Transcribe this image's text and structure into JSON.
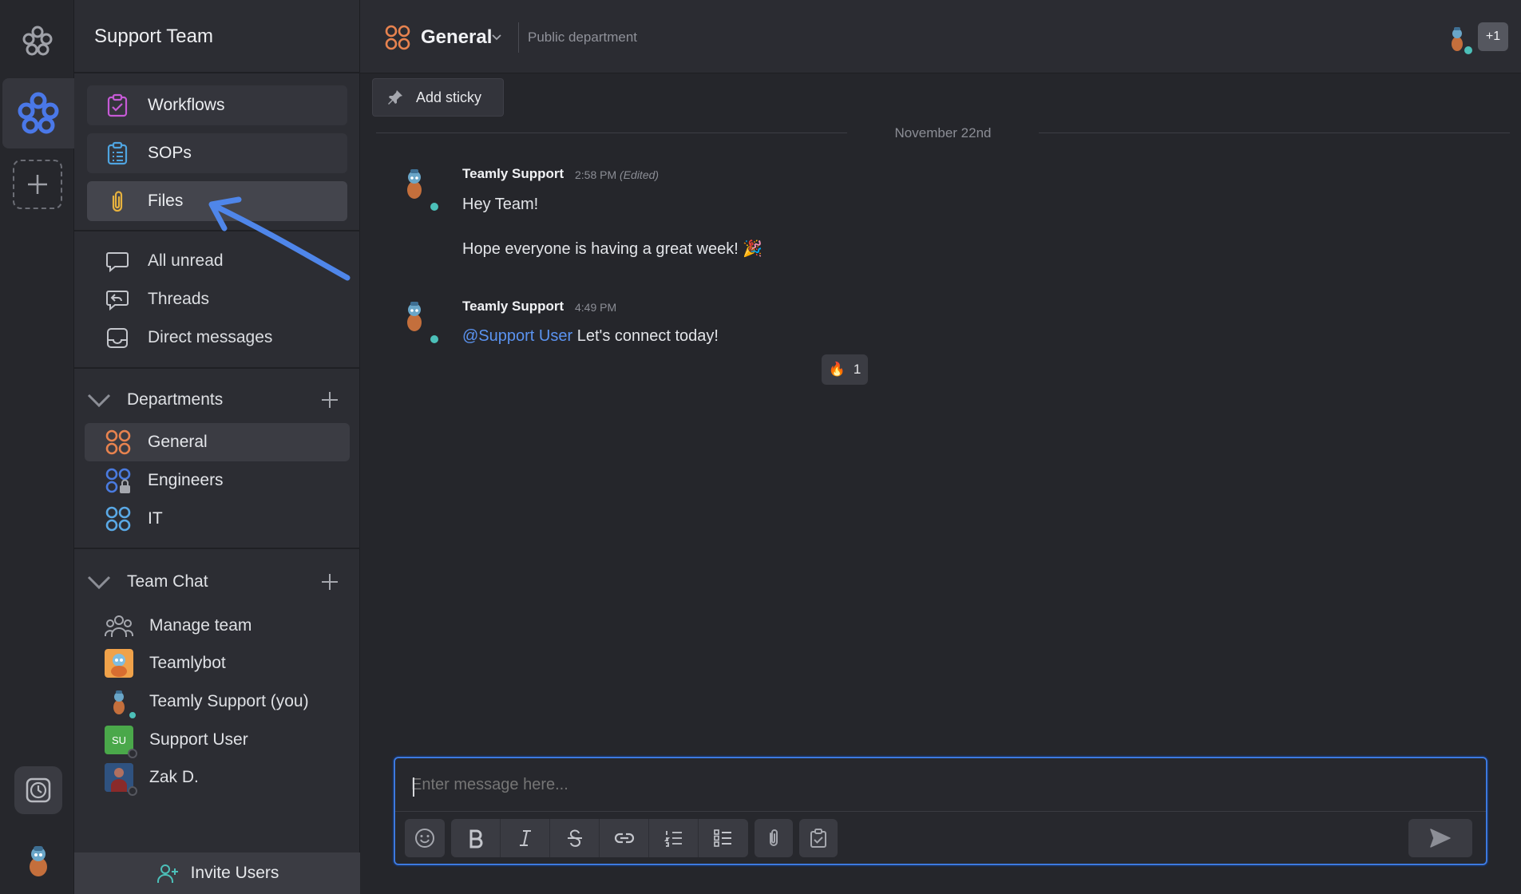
{
  "workspace": {
    "name": "Support Team"
  },
  "sidebar": {
    "tools": [
      {
        "label": "Workflows",
        "icon": "workflows-icon"
      },
      {
        "label": "SOPs",
        "icon": "sops-icon"
      },
      {
        "label": "Files",
        "icon": "paperclip-icon"
      }
    ],
    "nav": [
      {
        "label": "All unread",
        "icon": "chat-bubble-icon"
      },
      {
        "label": "Threads",
        "icon": "threads-icon"
      },
      {
        "label": "Direct messages",
        "icon": "inbox-icon"
      }
    ],
    "departments": {
      "title": "Departments",
      "items": [
        {
          "label": "General",
          "color": "#e8834f"
        },
        {
          "label": "Engineers",
          "color": "#4a7be0"
        },
        {
          "label": "IT",
          "color": "#5aa9e6"
        }
      ]
    },
    "team_chat": {
      "title": "Team Chat",
      "items": [
        {
          "label": "Manage team"
        },
        {
          "label": "Teamlybot"
        },
        {
          "label": "Teamly Support (you)"
        },
        {
          "label": "Support User",
          "initials": "SU"
        },
        {
          "label": "Zak D."
        }
      ]
    },
    "invite_label": "Invite Users"
  },
  "channel": {
    "name": "General",
    "description": "Public department",
    "extra_members": "+1",
    "sticky_label": "Add sticky"
  },
  "messages": {
    "date": "November 22nd",
    "items": [
      {
        "author": "Teamly Support",
        "time": "2:58 PM",
        "edited": "(Edited)",
        "greeting": "Hey Team!",
        "body": "Hope everyone is having a great week! 🎉"
      },
      {
        "author": "Teamly Support",
        "time": "4:49 PM",
        "mention": "@Support User",
        "body": "Let's connect today!",
        "reaction_emoji": "🔥",
        "reaction_count": "1"
      }
    ]
  },
  "composer": {
    "placeholder": "Enter message here..."
  },
  "colors": {
    "accent": "#3c79e0",
    "online": "#4cc0b9",
    "link": "#5b93f0"
  }
}
